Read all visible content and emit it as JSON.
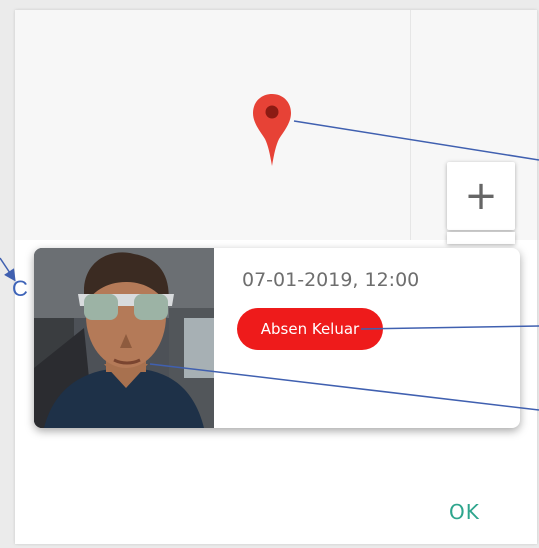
{
  "map": {
    "zoom_in_label": "+",
    "side_glyph": "C"
  },
  "card": {
    "timestamp": "07-01-2019, 12:00",
    "status_label": "Absen Keluar"
  },
  "dialog": {
    "ok_label": "OK"
  },
  "icons": [
    "map-pin-icon",
    "zoom-in-icon",
    "arrow-icon"
  ],
  "colors": {
    "pin": "#e74236",
    "status": "#ee1b1b",
    "ok": "#2ea58d",
    "annotation": "#4060b0"
  }
}
